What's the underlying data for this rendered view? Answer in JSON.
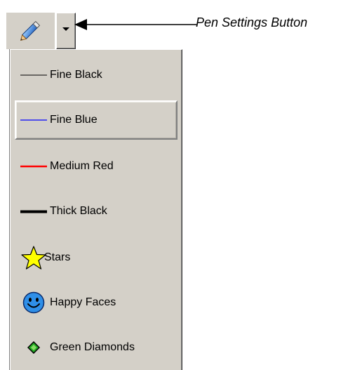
{
  "toolbar": {
    "pen_icon": "pencil-icon",
    "settings_icon": "chevron-down-icon"
  },
  "callout": {
    "label": "Pen Settings Button"
  },
  "menu": {
    "items": [
      {
        "label": "Fine Black",
        "icon": "fine-black-line",
        "color": "#000000"
      },
      {
        "label": "Fine Blue",
        "icon": "fine-blue-line",
        "color": "#0000ff"
      },
      {
        "label": "Medium Red",
        "icon": "medium-red-line",
        "color": "#ff0000"
      },
      {
        "label": "Thick Black",
        "icon": "thick-black-line",
        "color": "#000000"
      },
      {
        "label": "Stars",
        "icon": "star-icon",
        "color": "#ffff00"
      },
      {
        "label": "Happy Faces",
        "icon": "smiley-icon",
        "color": "#2f8fe8"
      },
      {
        "label": "Green Diamonds",
        "icon": "diamond-icon",
        "color": "#22aa22"
      }
    ],
    "selected_label": "Fine Blue"
  }
}
